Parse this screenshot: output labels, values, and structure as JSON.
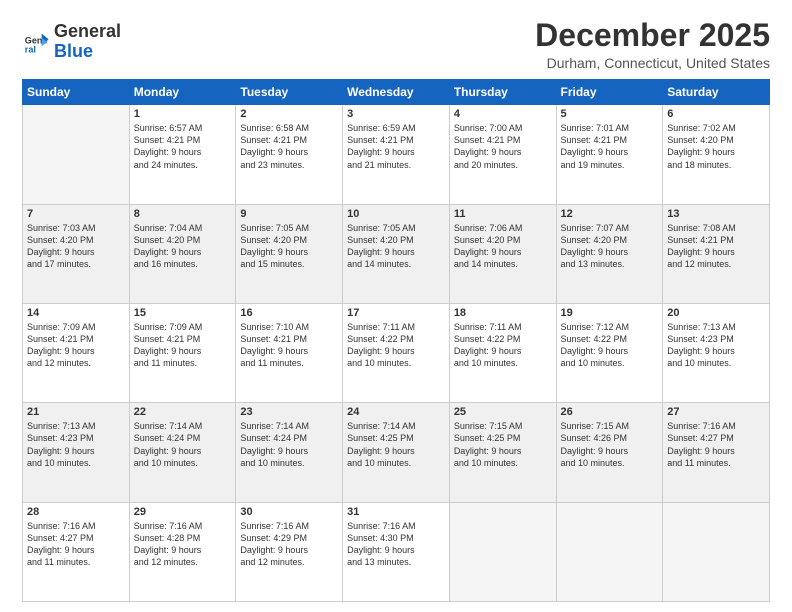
{
  "logo": {
    "line1": "General",
    "line2": "Blue"
  },
  "header": {
    "month": "December 2025",
    "location": "Durham, Connecticut, United States"
  },
  "weekdays": [
    "Sunday",
    "Monday",
    "Tuesday",
    "Wednesday",
    "Thursday",
    "Friday",
    "Saturday"
  ],
  "weeks": [
    [
      {
        "day": "",
        "content": ""
      },
      {
        "day": "1",
        "content": "Sunrise: 6:57 AM\nSunset: 4:21 PM\nDaylight: 9 hours\nand 24 minutes."
      },
      {
        "day": "2",
        "content": "Sunrise: 6:58 AM\nSunset: 4:21 PM\nDaylight: 9 hours\nand 23 minutes."
      },
      {
        "day": "3",
        "content": "Sunrise: 6:59 AM\nSunset: 4:21 PM\nDaylight: 9 hours\nand 21 minutes."
      },
      {
        "day": "4",
        "content": "Sunrise: 7:00 AM\nSunset: 4:21 PM\nDaylight: 9 hours\nand 20 minutes."
      },
      {
        "day": "5",
        "content": "Sunrise: 7:01 AM\nSunset: 4:21 PM\nDaylight: 9 hours\nand 19 minutes."
      },
      {
        "day": "6",
        "content": "Sunrise: 7:02 AM\nSunset: 4:20 PM\nDaylight: 9 hours\nand 18 minutes."
      }
    ],
    [
      {
        "day": "7",
        "content": "Sunrise: 7:03 AM\nSunset: 4:20 PM\nDaylight: 9 hours\nand 17 minutes."
      },
      {
        "day": "8",
        "content": "Sunrise: 7:04 AM\nSunset: 4:20 PM\nDaylight: 9 hours\nand 16 minutes."
      },
      {
        "day": "9",
        "content": "Sunrise: 7:05 AM\nSunset: 4:20 PM\nDaylight: 9 hours\nand 15 minutes."
      },
      {
        "day": "10",
        "content": "Sunrise: 7:05 AM\nSunset: 4:20 PM\nDaylight: 9 hours\nand 14 minutes."
      },
      {
        "day": "11",
        "content": "Sunrise: 7:06 AM\nSunset: 4:20 PM\nDaylight: 9 hours\nand 14 minutes."
      },
      {
        "day": "12",
        "content": "Sunrise: 7:07 AM\nSunset: 4:20 PM\nDaylight: 9 hours\nand 13 minutes."
      },
      {
        "day": "13",
        "content": "Sunrise: 7:08 AM\nSunset: 4:21 PM\nDaylight: 9 hours\nand 12 minutes."
      }
    ],
    [
      {
        "day": "14",
        "content": "Sunrise: 7:09 AM\nSunset: 4:21 PM\nDaylight: 9 hours\nand 12 minutes."
      },
      {
        "day": "15",
        "content": "Sunrise: 7:09 AM\nSunset: 4:21 PM\nDaylight: 9 hours\nand 11 minutes."
      },
      {
        "day": "16",
        "content": "Sunrise: 7:10 AM\nSunset: 4:21 PM\nDaylight: 9 hours\nand 11 minutes."
      },
      {
        "day": "17",
        "content": "Sunrise: 7:11 AM\nSunset: 4:22 PM\nDaylight: 9 hours\nand 10 minutes."
      },
      {
        "day": "18",
        "content": "Sunrise: 7:11 AM\nSunset: 4:22 PM\nDaylight: 9 hours\nand 10 minutes."
      },
      {
        "day": "19",
        "content": "Sunrise: 7:12 AM\nSunset: 4:22 PM\nDaylight: 9 hours\nand 10 minutes."
      },
      {
        "day": "20",
        "content": "Sunrise: 7:13 AM\nSunset: 4:23 PM\nDaylight: 9 hours\nand 10 minutes."
      }
    ],
    [
      {
        "day": "21",
        "content": "Sunrise: 7:13 AM\nSunset: 4:23 PM\nDaylight: 9 hours\nand 10 minutes."
      },
      {
        "day": "22",
        "content": "Sunrise: 7:14 AM\nSunset: 4:24 PM\nDaylight: 9 hours\nand 10 minutes."
      },
      {
        "day": "23",
        "content": "Sunrise: 7:14 AM\nSunset: 4:24 PM\nDaylight: 9 hours\nand 10 minutes."
      },
      {
        "day": "24",
        "content": "Sunrise: 7:14 AM\nSunset: 4:25 PM\nDaylight: 9 hours\nand 10 minutes."
      },
      {
        "day": "25",
        "content": "Sunrise: 7:15 AM\nSunset: 4:25 PM\nDaylight: 9 hours\nand 10 minutes."
      },
      {
        "day": "26",
        "content": "Sunrise: 7:15 AM\nSunset: 4:26 PM\nDaylight: 9 hours\nand 10 minutes."
      },
      {
        "day": "27",
        "content": "Sunrise: 7:16 AM\nSunset: 4:27 PM\nDaylight: 9 hours\nand 11 minutes."
      }
    ],
    [
      {
        "day": "28",
        "content": "Sunrise: 7:16 AM\nSunset: 4:27 PM\nDaylight: 9 hours\nand 11 minutes."
      },
      {
        "day": "29",
        "content": "Sunrise: 7:16 AM\nSunset: 4:28 PM\nDaylight: 9 hours\nand 12 minutes."
      },
      {
        "day": "30",
        "content": "Sunrise: 7:16 AM\nSunset: 4:29 PM\nDaylight: 9 hours\nand 12 minutes."
      },
      {
        "day": "31",
        "content": "Sunrise: 7:16 AM\nSunset: 4:30 PM\nDaylight: 9 hours\nand 13 minutes."
      },
      {
        "day": "",
        "content": ""
      },
      {
        "day": "",
        "content": ""
      },
      {
        "day": "",
        "content": ""
      }
    ]
  ]
}
